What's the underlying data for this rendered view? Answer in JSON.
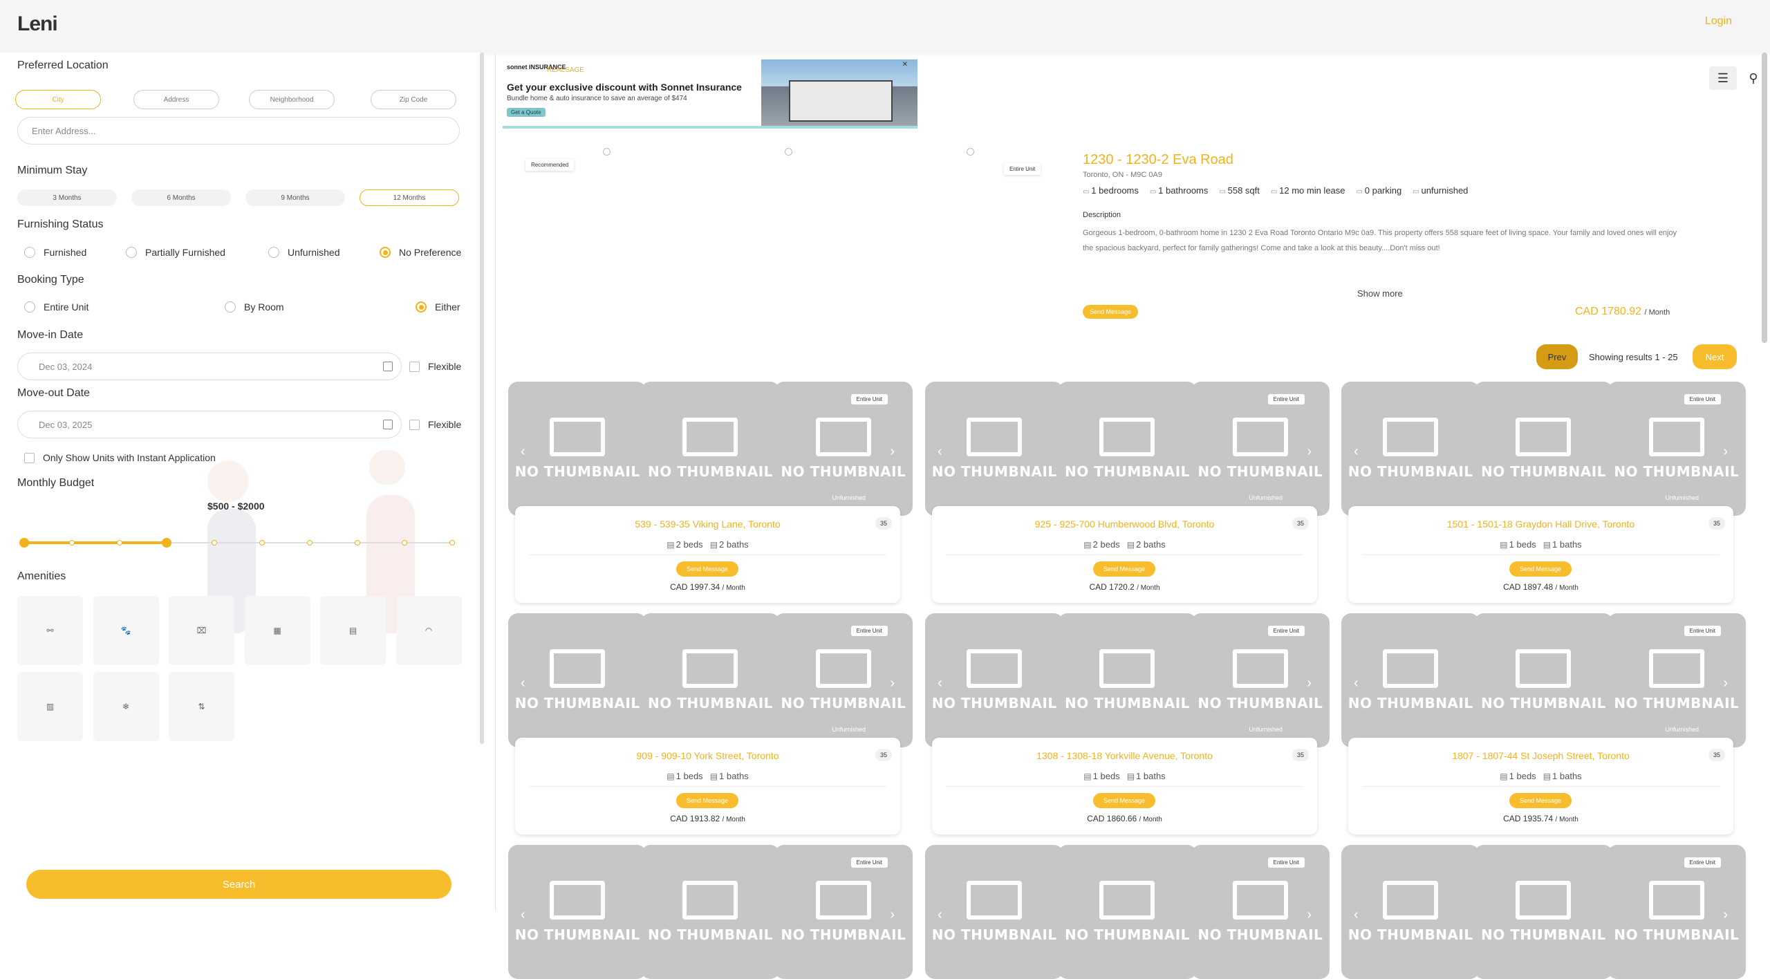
{
  "header": {
    "logo": "Leni",
    "login": "Login"
  },
  "filters": {
    "location": {
      "title": "Preferred Location",
      "tabs": [
        "City",
        "Address",
        "Neighborhood",
        "Zip Code"
      ],
      "active": "City",
      "placeholder": "Enter Address..."
    },
    "stay": {
      "title": "Minimum Stay",
      "options": [
        "3 Months",
        "6 Months",
        "9 Months",
        "12 Months"
      ],
      "selected": "12 Months"
    },
    "furnishing": {
      "title": "Furnishing Status",
      "options": [
        "Furnished",
        "Partially Furnished",
        "Unfurnished",
        "No Preference"
      ],
      "selected": "No Preference"
    },
    "booking": {
      "title": "Booking Type",
      "options": [
        "Entire Unit",
        "By Room",
        "Either"
      ],
      "selected": "Either"
    },
    "movein": {
      "title": "Move-in Date",
      "value": "Dec 03, 2024",
      "flexible": "Flexible"
    },
    "moveout": {
      "title": "Move-out Date",
      "value": "Dec 03, 2025",
      "flexible": "Flexible"
    },
    "instant": "Only Show Units with Instant Application",
    "budget": {
      "title": "Monthly Budget",
      "range": "$500 - $2000",
      "min": 500,
      "max": 2000
    },
    "amenities": {
      "title": "Amenities",
      "icons": [
        "parking-icon",
        "pet-icon",
        "laundry-icon",
        "gym-icon",
        "dishwasher-icon",
        "wifi-icon",
        "balcony-icon",
        "ac-icon",
        "elevator-icon"
      ],
      "glyphs": [
        "⚯",
        "🐾",
        "⌧",
        "▦",
        "▤",
        "◠",
        "▥",
        "❄",
        "⇅"
      ]
    },
    "search": "Search"
  },
  "banner": {
    "brand": "sonnet INSURANCE",
    "partner": "REALSAGE",
    "title": "Get your exclusive discount with Sonnet Insurance",
    "subtitle": "Bundle home & auto insurance to save an average of $474",
    "cta": "Get a Quote",
    "close": "✕"
  },
  "featured": {
    "tag_left": "Recommended",
    "tag_right": "Entire Unit",
    "title": "1230 - 1230-2 Eva Road",
    "address": "Toronto, ON - M9C 0A9",
    "specs": [
      "1 bedrooms",
      "1 bathrooms",
      "558 sqft",
      "12 mo min lease",
      "0 parking",
      "unfurnished"
    ],
    "desc_label": "Description",
    "description": "Gorgeous 1-bedroom, 0-bathroom home in 1230 2 Eva Road Toronto Ontario M9c 0a9. This property offers 558 square feet of living space. Your family and loved ones will enjoy the spacious backyard, perfect for family gatherings! Come and take a look at this beauty....Don't miss out!",
    "show_more": "Show more",
    "send": "Send Message",
    "price": "CAD 1780.92",
    "per": "/ Month"
  },
  "pager": {
    "prev": "Prev",
    "info": "Showing results 1 - 25",
    "next": "Next"
  },
  "view": {
    "list_icon": "☰",
    "map_icon": "⚲"
  },
  "cards": [
    {
      "title": "539 - 539-35 Viking Lane, Toronto",
      "count": "35",
      "beds": "2 beds",
      "baths": "2 baths",
      "price": "CAD 1997.34",
      "per": "/ Month",
      "tag": "Entire Unit",
      "furn": "Unfurnished"
    },
    {
      "title": "925 - 925-700 Humberwood Blvd, Toronto",
      "count": "35",
      "beds": "2 beds",
      "baths": "2 baths",
      "price": "CAD 1720.2",
      "per": "/ Month",
      "tag": "Entire Unit",
      "furn": "Unfurnished"
    },
    {
      "title": "1501 - 1501-18 Graydon Hall Drive, Toronto",
      "count": "35",
      "beds": "1 beds",
      "baths": "1 baths",
      "price": "CAD 1897.48",
      "per": "/ Month",
      "tag": "Entire Unit",
      "furn": "Unfurnished"
    },
    {
      "title": "909 - 909-10 York Street, Toronto",
      "count": "35",
      "beds": "1 beds",
      "baths": "1 baths",
      "price": "CAD 1913.82",
      "per": "/ Month",
      "tag": "Entire Unit",
      "furn": "Unfurnished"
    },
    {
      "title": "1308 - 1308-18 Yorkville Avenue, Toronto",
      "count": "35",
      "beds": "1 beds",
      "baths": "1 baths",
      "price": "CAD 1860.66",
      "per": "/ Month",
      "tag": "Entire Unit",
      "furn": "Unfurnished"
    },
    {
      "title": "1807 - 1807-44 St Joseph Street, Toronto",
      "count": "35",
      "beds": "1 beds",
      "baths": "1 baths",
      "price": "CAD 1935.74",
      "per": "/ Month",
      "tag": "Entire Unit",
      "furn": "Unfurnished"
    },
    {
      "title": "",
      "count": "",
      "beds": "",
      "baths": "",
      "price": "",
      "per": "",
      "tag": "Entire Unit",
      "furn": ""
    },
    {
      "title": "",
      "count": "",
      "beds": "",
      "baths": "",
      "price": "",
      "per": "",
      "tag": "Entire Unit",
      "furn": ""
    },
    {
      "title": "",
      "count": "",
      "beds": "",
      "baths": "",
      "price": "",
      "per": "",
      "tag": "Entire Unit",
      "furn": ""
    }
  ],
  "thumb_text": "NO THUMBNAIL",
  "send_label": "Send Message",
  "arrows": {
    "left": "‹",
    "right": "›"
  }
}
